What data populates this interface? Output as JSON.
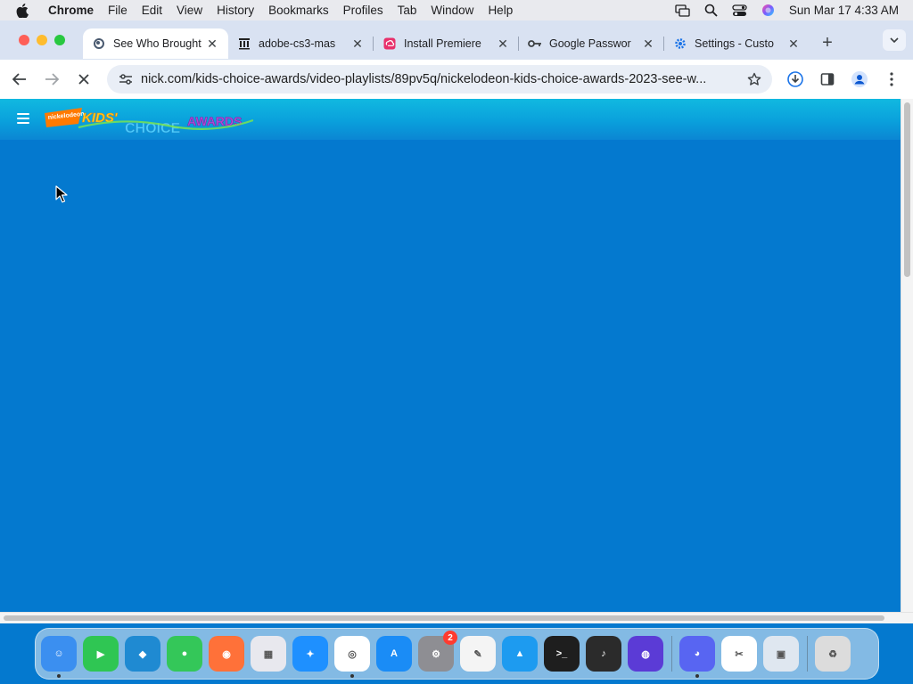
{
  "menubar": {
    "app_name": "Chrome",
    "items": [
      "File",
      "Edit",
      "View",
      "History",
      "Bookmarks",
      "Profiles",
      "Tab",
      "Window",
      "Help"
    ],
    "clock": "Sun Mar 17  4:33 AM"
  },
  "tabs": [
    {
      "title": "See Who Brought",
      "favicon": "nickelodeon-icon",
      "active": true
    },
    {
      "title": "adobe-cs3-mas",
      "favicon": "archive-icon",
      "active": false
    },
    {
      "title": "Install Premiere",
      "favicon": "creative-cloud-icon",
      "active": false
    },
    {
      "title": "Google Passwor",
      "favicon": "key-icon",
      "active": false
    },
    {
      "title": "Settings - Custo",
      "favicon": "gear-icon",
      "active": false
    }
  ],
  "toolbar": {
    "url": "nick.com/kids-choice-awards/video-playlists/89pv5q/nickelodeon-kids-choice-awards-2023-see-w..."
  },
  "site": {
    "logo_brand": "nickelodeon",
    "logo_text_1": "KIDS'",
    "logo_text_2": "CHOICE",
    "logo_text_3": "AWARDS",
    "header_color": "#0aa0dc",
    "background_color": "#0479cf"
  },
  "dock": {
    "apps": [
      {
        "name": "finder",
        "color": "#3b8ff0"
      },
      {
        "name": "facetime",
        "color": "#2fc653"
      },
      {
        "name": "vscode",
        "color": "#1f8ad2"
      },
      {
        "name": "messages",
        "color": "#34c759"
      },
      {
        "name": "firefox",
        "color": "#ff7139"
      },
      {
        "name": "launchpad",
        "color": "#e8e8ee"
      },
      {
        "name": "safari",
        "color": "#1e90ff"
      },
      {
        "name": "chrome",
        "color": "#ffffff"
      },
      {
        "name": "app-store",
        "color": "#1a8cf6"
      },
      {
        "name": "system-settings",
        "color": "#8e8e93",
        "badge": "2"
      },
      {
        "name": "textedit",
        "color": "#f4f4f4"
      },
      {
        "name": "keynote",
        "color": "#1d9bf0"
      },
      {
        "name": "terminal",
        "color": "#1e1e1e"
      },
      {
        "name": "garageband",
        "color": "#2b2b2b"
      },
      {
        "name": "siri",
        "color": "#5b3bd6"
      }
    ],
    "apps_right": [
      {
        "name": "discord",
        "color": "#5865f2"
      },
      {
        "name": "capcut",
        "color": "#ffffff"
      },
      {
        "name": "preview",
        "color": "#dfe7f0"
      },
      {
        "name": "trash",
        "color": "#dcdcdc"
      }
    ]
  }
}
